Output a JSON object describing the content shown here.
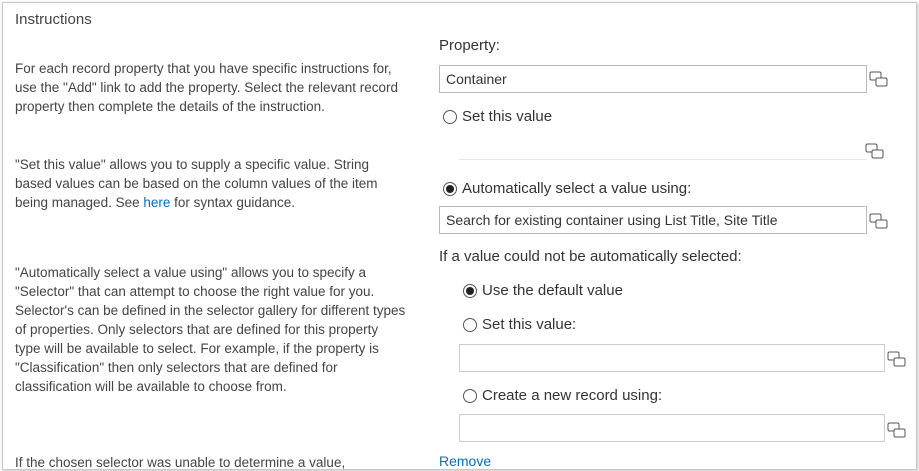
{
  "instructions": {
    "title": "Instructions",
    "para1": "For each record property that you have specific instructions for, use the \"Add\" link to add the property. Select the relevant record property then complete the details of the instruction.",
    "para2_before": "\"Set this value\" allows you to supply a specific value. String based values can be based on the column values of the item being managed. See ",
    "para2_link": "here",
    "para2_after": " for syntax guidance.",
    "para3": "\"Automatically select a value using\" allows you to specify a \"Selector\" that can attempt to choose the right value for you. Selector's can be defined in the selector gallery for different types of properties. Only selectors that are defined for this property type will be available to select. For example, if the property is \"Classification\" then only selectors that are defined for classification will be available to choose from.",
    "para4": "If the chosen selector was unable to determine a value,"
  },
  "form": {
    "property_label": "Property:",
    "property_value": "Container",
    "set_value_label": "Set this value",
    "auto_select_label": "Automatically select a value using:",
    "auto_select_value": "Search for existing container using List Title, Site Title",
    "fallback_heading": "If a value could not be automatically selected:",
    "use_default_label": "Use the default value",
    "set_value2_label": "Set this value:",
    "set_value2_value": "",
    "create_record_label": "Create a new record using:",
    "create_record_value": "",
    "remove_label": "Remove",
    "selected_mode": "auto_select",
    "selected_fallback": "use_default"
  }
}
